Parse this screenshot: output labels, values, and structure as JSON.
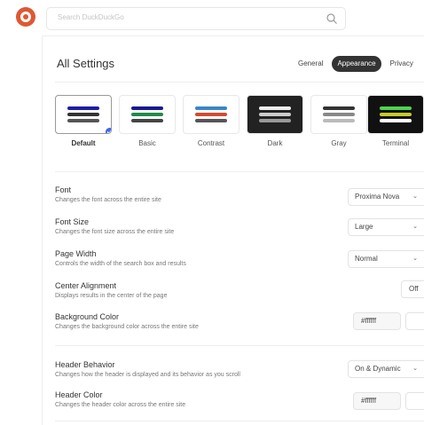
{
  "header": {
    "search_placeholder": "Search DuckDuckGo"
  },
  "page": {
    "title": "All Settings"
  },
  "tabs": [
    {
      "label": "General",
      "active": false
    },
    {
      "label": "Appearance",
      "active": true
    },
    {
      "label": "Privacy",
      "active": false
    }
  ],
  "themes": [
    {
      "label": "Default",
      "selected": true,
      "bg": "#ffffff",
      "bars": [
        "#1d1da8",
        "#333333",
        "#555555"
      ]
    },
    {
      "label": "Basic",
      "selected": false,
      "bg": "#ffffff",
      "bars": [
        "#1a1a8f",
        "#1f8a4c",
        "#444444"
      ]
    },
    {
      "label": "Contrast",
      "selected": false,
      "bg": "#ffffff",
      "bars": [
        "#3a86c7",
        "#d14b30",
        "#555555"
      ]
    },
    {
      "label": "Dark",
      "selected": false,
      "bg": "#222222",
      "bars": [
        "#eeeeee",
        "#cccccc",
        "#999999"
      ]
    },
    {
      "label": "Gray",
      "selected": false,
      "bg": "#ffffff",
      "bars": [
        "#333333",
        "#888888",
        "#bbbbbb"
      ]
    },
    {
      "label": "Terminal",
      "selected": false,
      "bg": "#111111",
      "bars": [
        "#4fd34f",
        "#c8c832",
        "#ffffff"
      ]
    }
  ],
  "settings": {
    "font": {
      "label": "Font",
      "desc": "Changes the font across the entire site",
      "value": "Proxima Nova"
    },
    "font_size": {
      "label": "Font Size",
      "desc": "Changes the font size across the entire site",
      "value": "Large"
    },
    "page_width": {
      "label": "Page Width",
      "desc": "Controls the width of the search box and results",
      "value": "Normal"
    },
    "center_alignment": {
      "label": "Center Alignment",
      "desc": "Displays results in the center of the page",
      "value": "Off"
    },
    "background_color": {
      "label": "Background Color",
      "desc": "Changes the background color across the entire site",
      "value": "#ffffff"
    },
    "header_behavior": {
      "label": "Header Behavior",
      "desc": "Changes how the header is displayed and its behavior as you scroll",
      "value": "On & Dynamic"
    },
    "header_color": {
      "label": "Header Color",
      "desc": "Changes the header color across the entire site",
      "value": "#ffffff"
    }
  },
  "icons": {
    "chevron": "chevron-down-icon",
    "check": "check-icon",
    "search": "search-icon",
    "logo": "duckduckgo-logo"
  }
}
